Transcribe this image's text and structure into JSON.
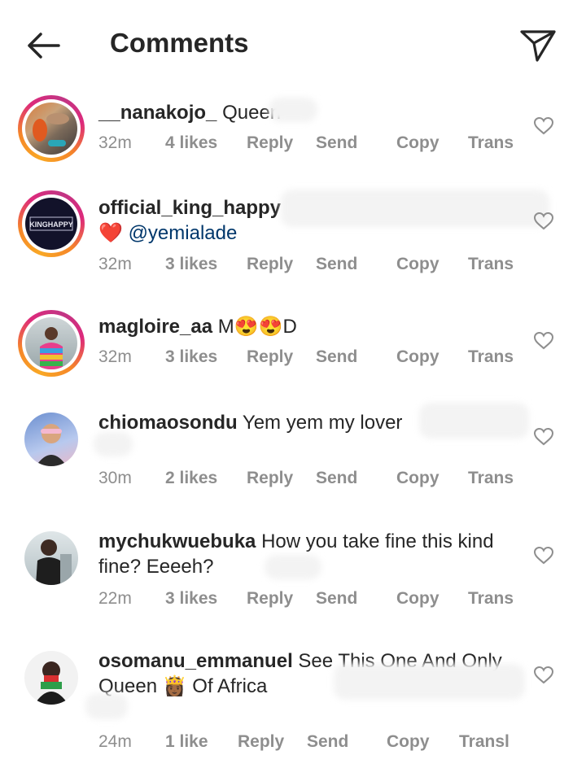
{
  "header": {
    "title": "Comments"
  },
  "comments": [
    {
      "username": "__nanakojo_",
      "text": "Queen",
      "time": "32m",
      "likes": "4 likes",
      "reply": "Reply",
      "send": "Send",
      "copy": "Copy",
      "trans": "Trans"
    },
    {
      "username": "official_king_happy",
      "heart": "❤️",
      "mention": "@yemialade",
      "time": "32m",
      "likes": "3 likes",
      "reply": "Reply",
      "send": "Send",
      "copy": "Copy",
      "trans": "Trans",
      "avatar_text": "KINGHAPPY"
    },
    {
      "username": "magloire_aa",
      "text": "M😍😍D",
      "time": "32m",
      "likes": "3 likes",
      "reply": "Reply",
      "send": "Send",
      "copy": "Copy",
      "trans": "Trans"
    },
    {
      "username": "chiomaosondu",
      "text": "Yem yem my lover",
      "time": "30m",
      "likes": "2 likes",
      "reply": "Reply",
      "send": "Send",
      "copy": "Copy",
      "trans": "Trans"
    },
    {
      "username": "mychukwuebuka",
      "text": "How you take fine this kind fine? Eeeeh?",
      "time": "22m",
      "likes": "3 likes",
      "reply": "Reply",
      "send": "Send",
      "copy": "Copy",
      "trans": "Trans"
    },
    {
      "username": "osomanu_emmanuel",
      "text": "See This One And Only Queen 👸🏾 Of Africa",
      "time": "24m",
      "likes": "1 like",
      "reply": "Reply",
      "send": "Send",
      "copy": "Copy",
      "trans": "Transl"
    }
  ]
}
